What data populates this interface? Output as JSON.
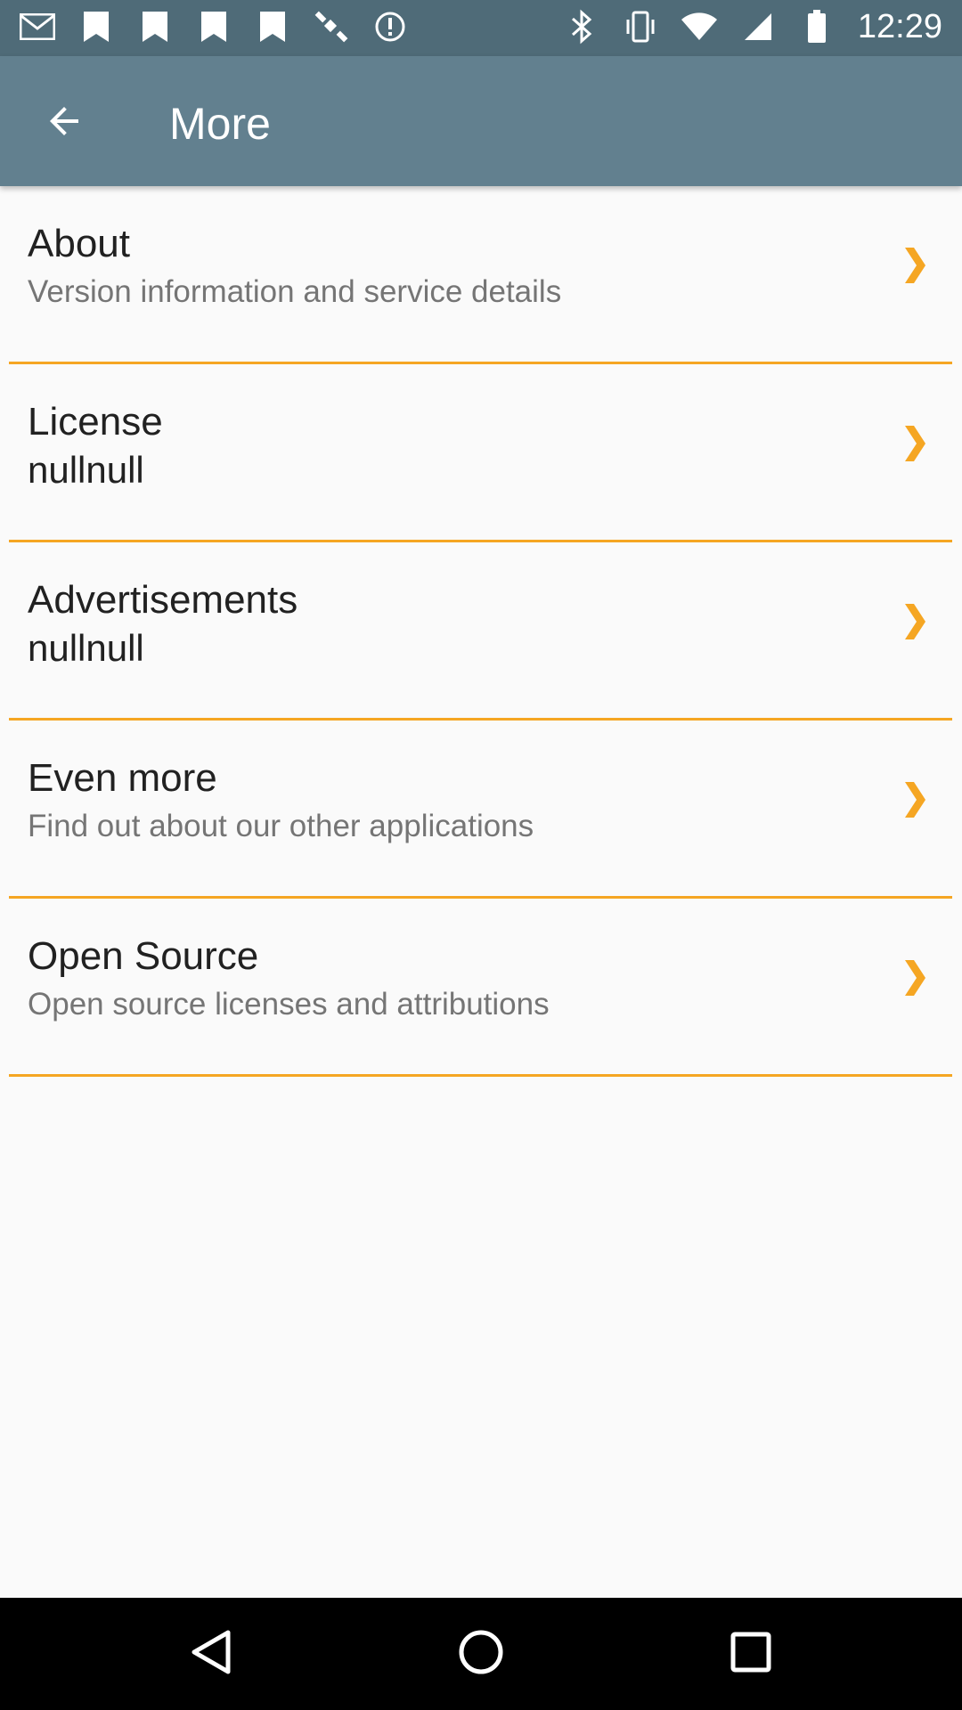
{
  "status_bar": {
    "time": "12:29",
    "left_icons": [
      "gmail-icon",
      "box-icon",
      "box-icon",
      "box-icon",
      "box-icon",
      "satellite-icon",
      "alert-icon"
    ],
    "right_icons": [
      "bluetooth-icon",
      "vibrate-icon",
      "wifi-icon",
      "signal-icon",
      "battery-icon"
    ]
  },
  "app_bar": {
    "title": "More",
    "back_icon": "arrow-back-icon"
  },
  "colors": {
    "status_bar": "#4f6b78",
    "app_bar": "#62808f",
    "accent": "#f5a623",
    "background": "#fafafa"
  },
  "list": {
    "items": [
      {
        "title": "About",
        "subtitle": "Version information and service details"
      },
      {
        "title": "License",
        "subtitle": "nullnull"
      },
      {
        "title": "Advertisements",
        "subtitle": "nullnull"
      },
      {
        "title": "Even more",
        "subtitle": "Find out about our other applications"
      },
      {
        "title": "Open Source",
        "subtitle": "Open source licenses and attributions"
      }
    ]
  },
  "nav_bar": {
    "buttons": [
      "back-triangle-icon",
      "home-circle-icon",
      "recents-square-icon"
    ]
  }
}
